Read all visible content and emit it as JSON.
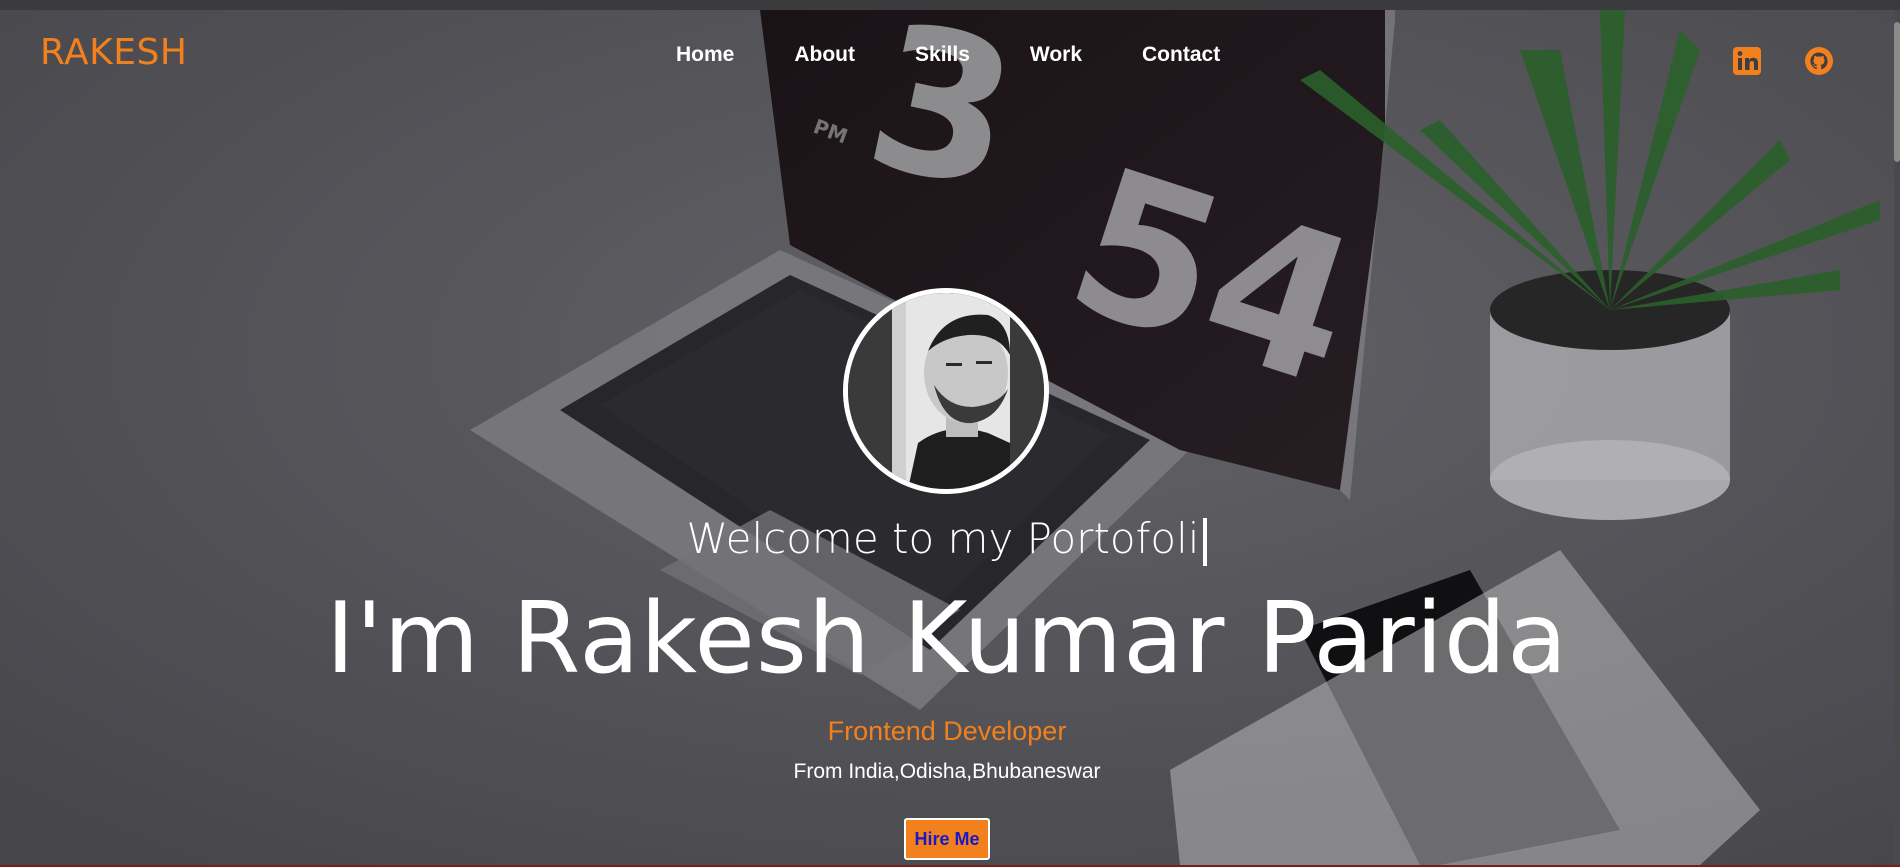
{
  "brand": {
    "logo_text": "RAKESH",
    "accent": "#f2811d"
  },
  "nav": {
    "items": [
      {
        "label": "Home"
      },
      {
        "label": "About"
      },
      {
        "label": "Skills"
      },
      {
        "label": "Work"
      },
      {
        "label": "Contact"
      }
    ]
  },
  "social": {
    "items": [
      {
        "icon": "linkedin-icon"
      },
      {
        "icon": "github-icon"
      }
    ]
  },
  "hero": {
    "welcome_text": "Welcome to my Portofoli",
    "name": "I'm Rakesh Kumar Parida",
    "role": "Frontend Developer",
    "location": "From India,Odisha,Bhubaneswar",
    "cta_label": "Hire Me",
    "cta_text_color": "#1a18c7",
    "clock_hour": "3",
    "clock_minutes": "54",
    "clock_period": "PM"
  }
}
